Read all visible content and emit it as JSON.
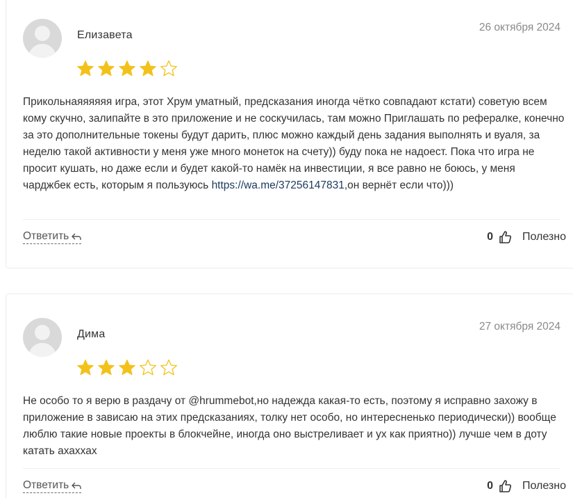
{
  "colors": {
    "star": "#f2c21b",
    "link": "#1a3a5c"
  },
  "reviews": [
    {
      "author": "Елизавета",
      "date": "26 октября 2024",
      "rating": 4,
      "max_rating": 5,
      "text_before_link": "Прикольнаяяяяяя игра, этот Хрум уматный, предсказания иногда чётко совпадают кстати) советую всем кому скучно, залипайте в это приложение и не соскучилась, там можно Приглашать по рефералке, конечно за это дополнительные токены будут дарить, плюс можно каждый день задания выполнять и вуаля, за неделю такой активности у меня уже много монеток на счету)) буду пока не надоест. Пока что игра не просит кушать, но даже если и будет какой-то намёк на инвестиции, я все равно не боюсь, у меня чарджбек есть, которым я пользуюсь ",
      "link": "https://wa.me/37256147831",
      "text_after_link": ",он вернёт если что)))",
      "reply_label": "Ответить",
      "helpful_count": "0",
      "helpful_label": "Полезно"
    },
    {
      "author": "Дима",
      "date": "27 октября 2024",
      "rating": 3,
      "max_rating": 5,
      "text_before_link": "Не особо то я верю в раздачу от @hrummebot,но надежда какая-то есть, поэтому я исправно захожу в приложение в зависаю на этих предсказаниях, толку нет особо, но интересненько периодически)) вообще люблю такие новые проекты в блокчейне, иногда оно выстреливает и ух как приятно)) лучше чем в доту катать ахаххах",
      "link": "",
      "text_after_link": "",
      "reply_label": "Ответить",
      "helpful_count": "0",
      "helpful_label": "Полезно"
    }
  ]
}
